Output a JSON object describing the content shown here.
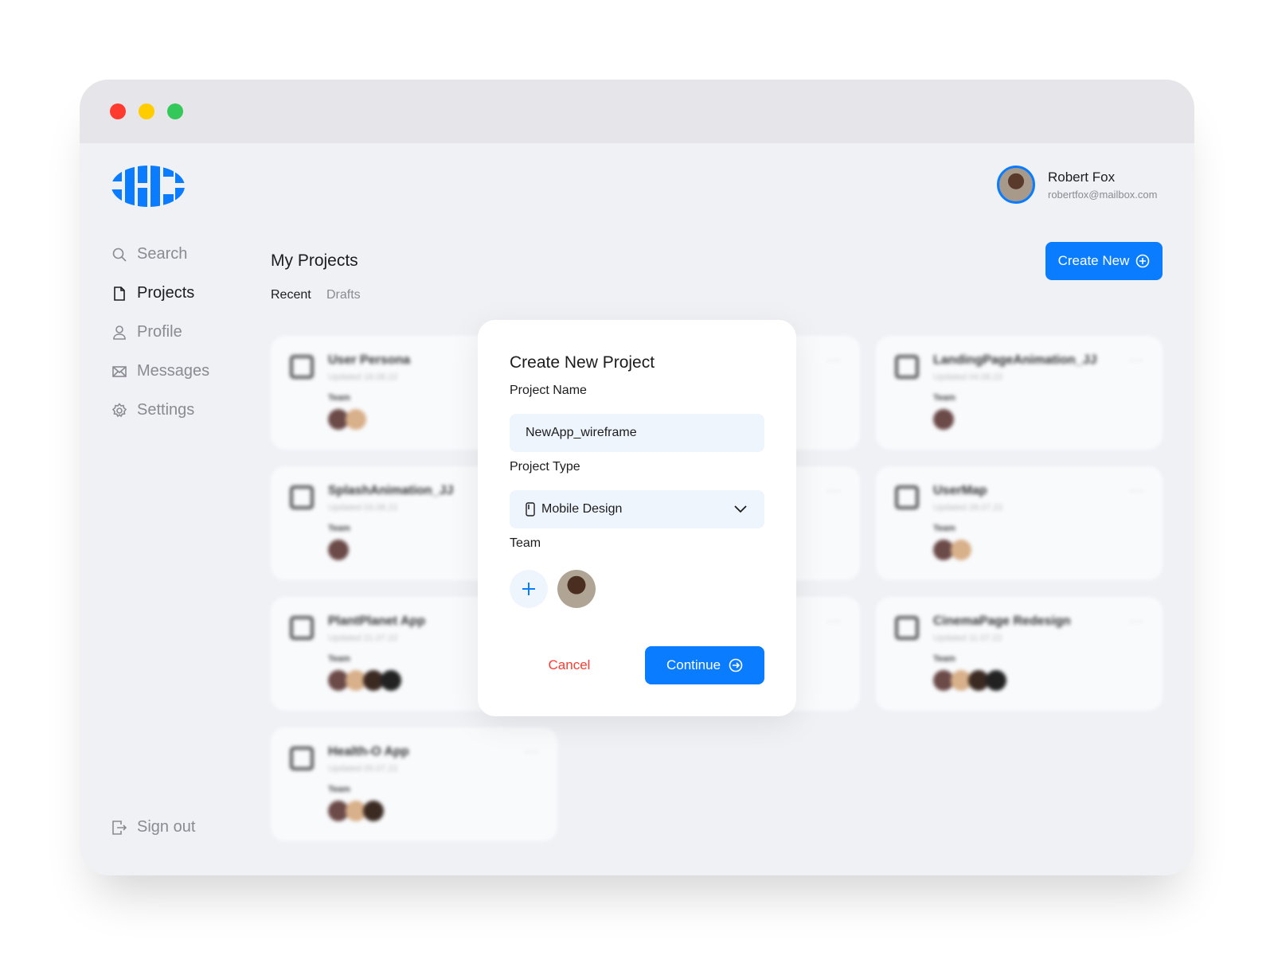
{
  "window": {
    "controls": [
      "close",
      "minimize",
      "maximize"
    ],
    "colors": {
      "close": "#ff3b30",
      "minimize": "#ffcc00",
      "maximize": "#34c759"
    }
  },
  "brand": {
    "accent": "#0a7cff"
  },
  "sidebar": {
    "items": [
      {
        "label": "Search",
        "icon": "search-icon"
      },
      {
        "label": "Projects",
        "icon": "file-icon",
        "active": true
      },
      {
        "label": "Profile",
        "icon": "user-icon"
      },
      {
        "label": "Messages",
        "icon": "mail-icon"
      },
      {
        "label": "Settings",
        "icon": "gear-icon"
      }
    ],
    "sign_out": "Sign out"
  },
  "user": {
    "name": "Robert Fox",
    "email": "robertfox@mailbox.com"
  },
  "main": {
    "title": "My Projects",
    "tabs": [
      {
        "label": "Recent",
        "active": true
      },
      {
        "label": "Drafts"
      }
    ],
    "create_label": "Create New"
  },
  "projects": [
    {
      "name": "User Persona",
      "updated": "Updated 18.08.22",
      "team_label": "Team",
      "members": 2,
      "icon": "pen-icon"
    },
    {
      "name": "SplashAnimation_JJ",
      "updated": "Updated 03.08.22",
      "team_label": "Team",
      "members": 1,
      "icon": "film-icon"
    },
    {
      "name": "PlantPlanet App",
      "updated": "Updated 21.07.22",
      "team_label": "Team",
      "members": 4,
      "icon": "mobile-icon"
    },
    {
      "name": "Health-O App",
      "updated": "Updated 05.07.22",
      "team_label": "Team",
      "members": 3,
      "icon": "mobile-icon"
    },
    {
      "name": "LandingPageAnimation_JJ",
      "updated": "Updated 04.08.22",
      "team_label": "Team",
      "members": 1,
      "icon": "film-icon"
    },
    {
      "name": "UserMap",
      "updated": "Updated 28.07.22",
      "team_label": "Team",
      "members": 2,
      "icon": "pen-icon"
    },
    {
      "name": "CinemaPage Redesign",
      "updated": "Updated 11.07.22",
      "team_label": "Team",
      "members": 4,
      "icon": "monitor-icon"
    }
  ],
  "modal": {
    "title": "Create New Project",
    "name_label": "Project Name",
    "name_value": "NewApp_wireframe",
    "type_label": "Project Type",
    "type_value": "Mobile Design",
    "team_label": "Team",
    "cancel": "Cancel",
    "continue": "Continue"
  }
}
